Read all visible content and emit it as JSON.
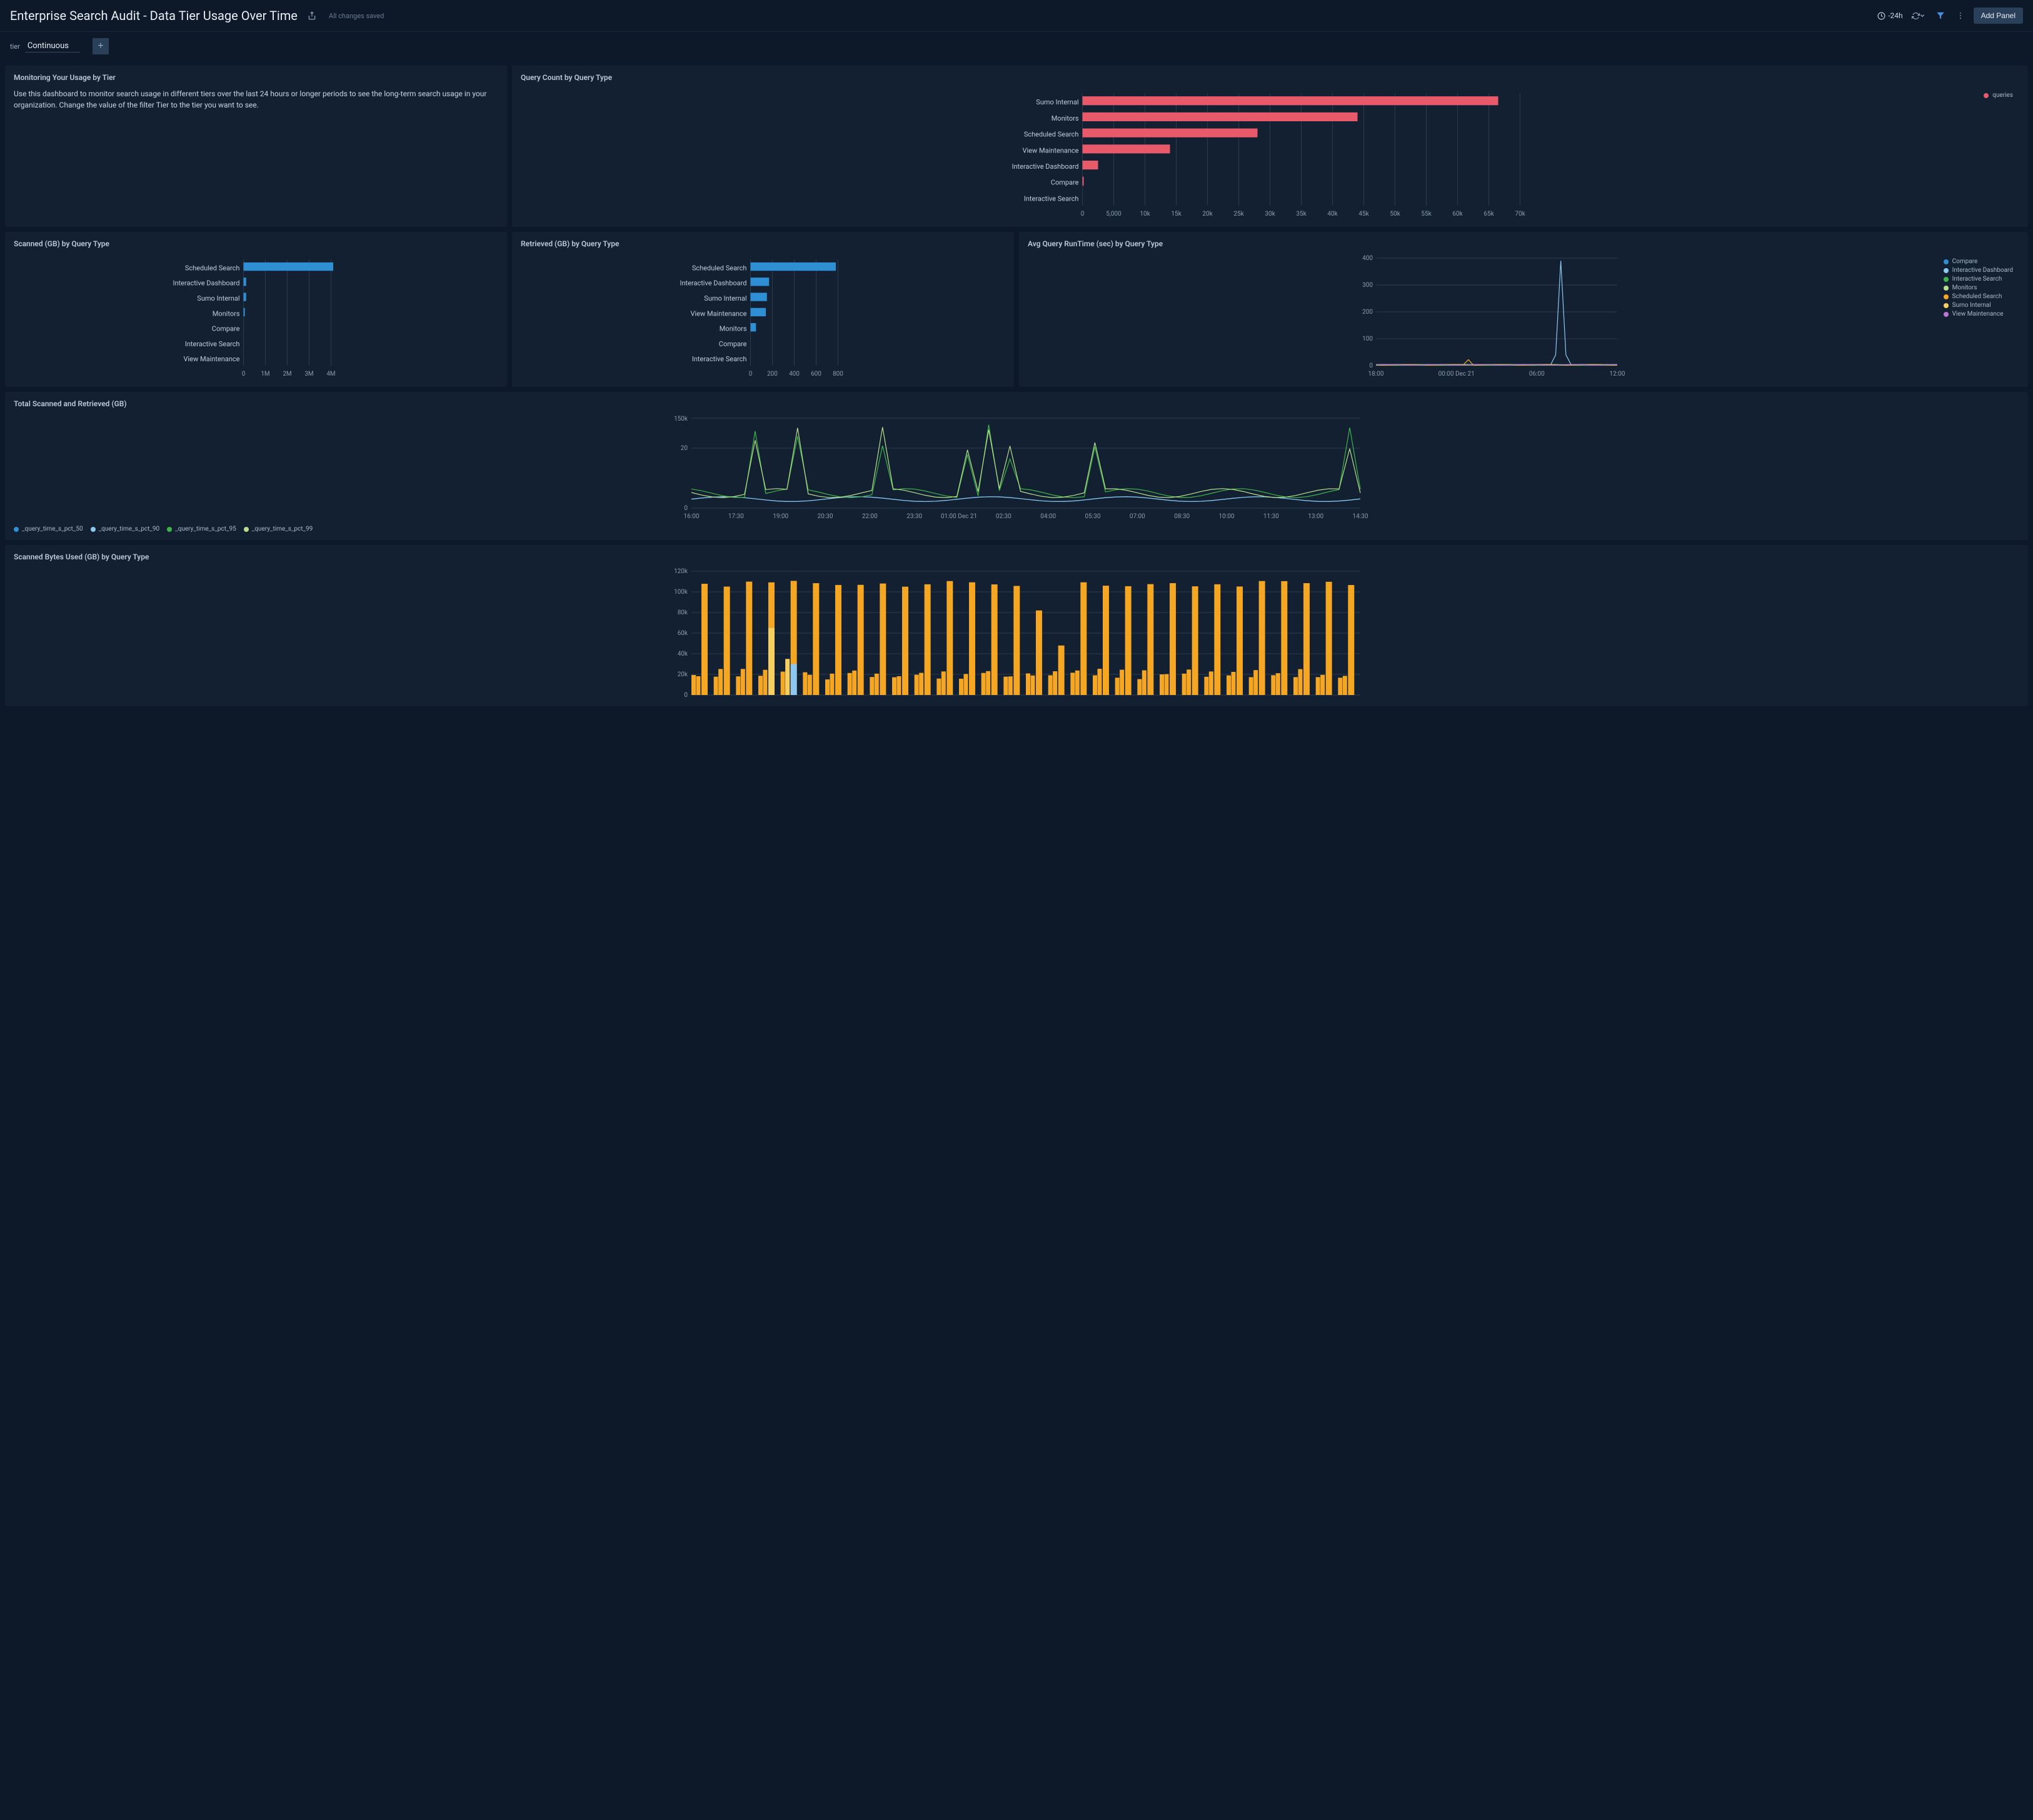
{
  "header": {
    "title": "Enterprise Search Audit - Data Tier Usage Over Time",
    "save_status": "All changes saved",
    "time_range": "-24h",
    "add_panel_label": "Add Panel"
  },
  "filter": {
    "label": "tier",
    "value": "Continuous"
  },
  "panels": {
    "info": {
      "title": "Monitoring Your Usage by Tier",
      "text": "Use this dashboard to monitor search usage in different tiers over the last 24 hours or longer periods to see the long-term search usage in your organization. Change the value of the filter Tier to the tier you want to see."
    },
    "query_count": {
      "title": "Query Count by Query Type",
      "legend": "queries"
    },
    "scanned_gb": {
      "title": "Scanned (GB) by Query Type"
    },
    "retrieved_gb": {
      "title": "Retrieved (GB) by Query Type"
    },
    "runtime": {
      "title": "Avg Query RunTime (sec) by Query Type"
    },
    "total_sr": {
      "title": "Total Scanned and Retrieved (GB)"
    },
    "scanned_bytes": {
      "title": "Scanned Bytes Used (GB) by Query Type"
    }
  },
  "chart_data": [
    {
      "id": "query_count",
      "type": "bar",
      "orientation": "horizontal",
      "categories": [
        "Sumo Internal",
        "Monitors",
        "Scheduled Search",
        "View Maintenance",
        "Interactive Dashboard",
        "Compare",
        "Interactive Search"
      ],
      "values": [
        66500,
        44000,
        28000,
        14000,
        2500,
        200,
        0
      ],
      "xlim": [
        0,
        70000
      ],
      "xticks": [
        0,
        5000,
        10000,
        15000,
        20000,
        25000,
        30000,
        35000,
        40000,
        45000,
        50000,
        55000,
        60000,
        65000,
        70000
      ],
      "xtick_labels": [
        "0",
        "5,000",
        "10k",
        "15k",
        "20k",
        "25k",
        "30k",
        "35k",
        "40k",
        "45k",
        "50k",
        "55k",
        "60k",
        "65k",
        "70k"
      ],
      "color": "#e85a6a",
      "legend": [
        "queries"
      ]
    },
    {
      "id": "scanned_gb",
      "type": "bar",
      "orientation": "horizontal",
      "categories": [
        "Scheduled Search",
        "Interactive Dashboard",
        "Sumo Internal",
        "Monitors",
        "Compare",
        "Interactive Search",
        "View Maintenance"
      ],
      "values": [
        4100000,
        120000,
        120000,
        60000,
        0,
        0,
        0
      ],
      "xlim": [
        0,
        4000000
      ],
      "xticks": [
        0,
        1000000,
        2000000,
        3000000,
        4000000
      ],
      "xtick_labels": [
        "0",
        "1M",
        "2M",
        "3M",
        "4M"
      ],
      "color": "#2f8fd4"
    },
    {
      "id": "retrieved_gb",
      "type": "bar",
      "orientation": "horizontal",
      "categories": [
        "Scheduled Search",
        "Interactive Dashboard",
        "Sumo Internal",
        "View Maintenance",
        "Monitors",
        "Compare",
        "Interactive Search"
      ],
      "values": [
        780,
        170,
        150,
        140,
        50,
        0,
        0
      ],
      "xlim": [
        0,
        800
      ],
      "xticks": [
        0,
        200,
        400,
        600,
        800
      ],
      "xtick_labels": [
        "0",
        "200",
        "400",
        "600",
        "800"
      ],
      "color": "#2f8fd4"
    },
    {
      "id": "runtime",
      "type": "line",
      "x_labels": [
        "18:00",
        "00:00 Dec 21",
        "06:00",
        "12:00"
      ],
      "ylim": [
        0,
        400
      ],
      "yticks": [
        0,
        100,
        200,
        300,
        400
      ],
      "series": [
        {
          "name": "Compare",
          "color": "#2f8fd4"
        },
        {
          "name": "Interactive Dashboard",
          "color": "#8cc8f0"
        },
        {
          "name": "Interactive Search",
          "color": "#3eb54a"
        },
        {
          "name": "Monitors",
          "color": "#b8e08a"
        },
        {
          "name": "Scheduled Search",
          "color": "#f5a623"
        },
        {
          "name": "Sumo Internal",
          "color": "#f5d060"
        },
        {
          "name": "View Maintenance",
          "color": "#b877d6"
        }
      ],
      "note": "Mostly flat near 0 with a sharp spike to ~390 around 12:00 and a small bump ~25 at ~03:30"
    },
    {
      "id": "total_sr",
      "type": "line",
      "ylim": [
        0,
        150000
      ],
      "yticks": [
        0,
        20,
        150000
      ],
      "ytick_labels": [
        "0",
        "20",
        "150k"
      ],
      "x_labels": [
        "16:00",
        "17:30",
        "19:00",
        "20:30",
        "22:00",
        "23:30",
        "01:00 Dec 21",
        "02:30",
        "04:00",
        "05:30",
        "07:00",
        "08:30",
        "10:00",
        "11:30",
        "13:00",
        "14:30"
      ],
      "series": [
        {
          "name": "_query_time_s_pct_50",
          "color": "#2f8fd4"
        },
        {
          "name": "_query_time_s_pct_90",
          "color": "#8cc8f0"
        },
        {
          "name": "_query_time_s_pct_95",
          "color": "#3eb54a"
        },
        {
          "name": "_query_time_s_pct_99",
          "color": "#b8e08a"
        }
      ],
      "note": "pct_95/99 show multiple spikes to ~18-30 at 17:30,19:00,01:00-02:30,05:30,14:30; pct_50/90 stay low ~3-6"
    },
    {
      "id": "scanned_bytes",
      "type": "bar",
      "ylim": [
        0,
        120000
      ],
      "yticks": [
        0,
        20000,
        40000,
        60000,
        80000,
        100000,
        120000
      ],
      "ytick_labels": [
        "0",
        "20k",
        "40k",
        "60k",
        "80k",
        "100k",
        "120k"
      ],
      "note": "~30 primary orange bars around 105-110k hourly, with preceding/trailing shorter bars ~15-25k; a few 50-90k exceptions mid-series",
      "colors": [
        "#f5a623",
        "#f5d060",
        "#8cc8f0",
        "#2f8fd4"
      ]
    }
  ]
}
